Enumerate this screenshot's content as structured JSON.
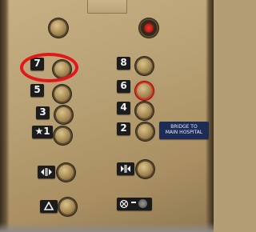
{
  "buttons": [
    {
      "label": "7",
      "state": "highlighted"
    },
    {
      "label": "8",
      "state": "normal"
    },
    {
      "label": "5",
      "state": "normal"
    },
    {
      "label": "6",
      "state": "lit"
    },
    {
      "label": "3",
      "state": "normal"
    },
    {
      "label": "4",
      "state": "normal"
    },
    {
      "label": "★1",
      "state": "normal"
    },
    {
      "label": "2",
      "state": "normal"
    }
  ],
  "sign": {
    "line1": "BRIDGE TO",
    "line2": "MAIN HOSPITAL"
  },
  "icons": [
    "door-open-icon",
    "door-close-icon",
    "alarm-bell-icon",
    "emergency-phone-icon",
    "fire-service-key-icon"
  ],
  "colors": {
    "highlight": "#e3171b",
    "lit_ring": "#e03024",
    "sign_bg": "#1d2b57",
    "panel": "#b8a174"
  }
}
